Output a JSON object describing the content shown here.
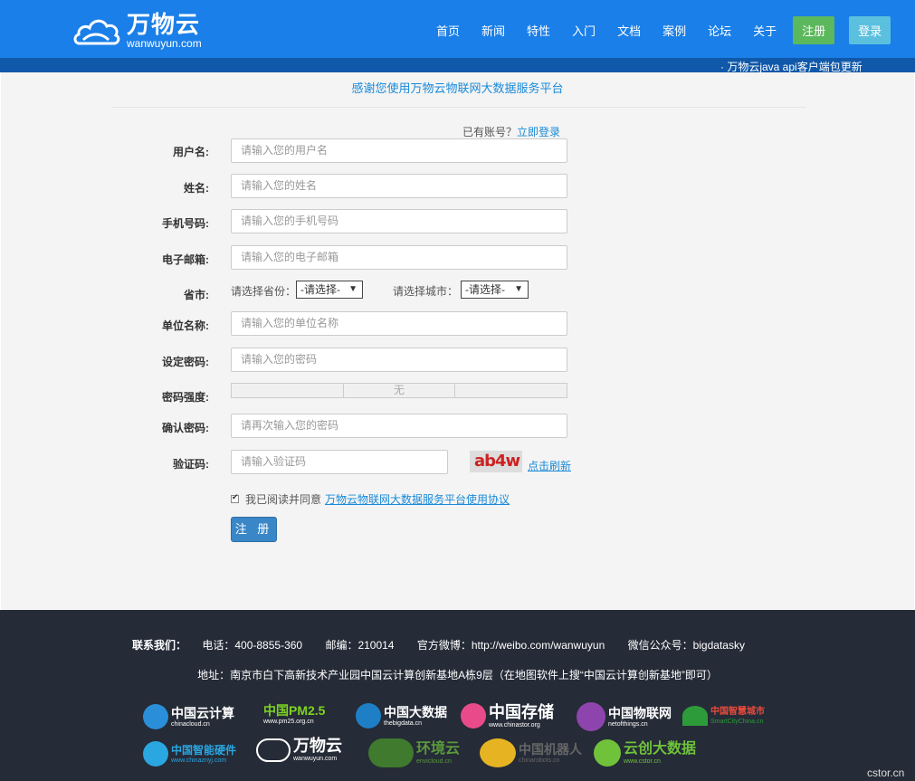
{
  "header": {
    "logo_cn": "万物云",
    "logo_en": "wanwuyun.com",
    "nav": [
      "首页",
      "新闻",
      "特性",
      "入门",
      "文档",
      "案例",
      "论坛",
      "关于"
    ],
    "register_label": "注册",
    "login_label": "登录"
  },
  "marquee": {
    "text": "· 万物云java api客户端包更新"
  },
  "main": {
    "thanks": "感谢您使用万物云物联网大数据服务平台",
    "have_account": "已有账号？",
    "login_link": "立即登录"
  },
  "form": {
    "username": {
      "label": "用户名:",
      "placeholder": "请输入您的用户名"
    },
    "name": {
      "label": "姓名:",
      "placeholder": "请输入您的姓名"
    },
    "phone": {
      "label": "手机号码:",
      "placeholder": "请输入您的手机号码"
    },
    "email": {
      "label": "电子邮箱:",
      "placeholder": "请输入您的电子邮箱"
    },
    "region": {
      "label": "省市:",
      "province_label": "请选择省份：",
      "province_value": "-请选择-",
      "city_label": "请选择城市：",
      "city_value": "-请选择-"
    },
    "company": {
      "label": "单位名称:",
      "placeholder": "请输入您的单位名称"
    },
    "password": {
      "label": "设定密码:",
      "placeholder": "请输入您的密码"
    },
    "strength": {
      "label": "密码强度:",
      "levels": [
        "",
        "无",
        ""
      ]
    },
    "confirm": {
      "label": "确认密码:",
      "placeholder": "请再次输入您的密码"
    },
    "captcha": {
      "label": "验证码:",
      "placeholder": "请输入验证码",
      "image_text": "ab4w",
      "refresh": "点击刷新"
    },
    "agree": {
      "text": "我已阅读并同意",
      "link": "万物云物联网大数据服务平台使用协议",
      "checked": true
    },
    "submit": "注 册"
  },
  "footer": {
    "contact_label": "联系我们：",
    "phone": "电话：400-8855-360",
    "postcode": "邮编：210014",
    "weibo": "官方微博：http://weibo.com/wanwuyun",
    "wechat": "微信公众号：bigdatasky",
    "address": "地址：南京市白下高新技术产业园中国云计算创新基地A栋9层（在地图软件上搜“中国云计算创新基地”即可）",
    "partners_row1": [
      {
        "name": "中国云计算",
        "url": "chinacloud.cn",
        "color": "#ffffff"
      },
      {
        "name": "中国PM2.5",
        "url": "www.pm25.org.cn",
        "color": "#7ed321"
      },
      {
        "name": "中国大数据",
        "url": "thebigdata.cn",
        "color": "#ffffff"
      },
      {
        "name": "中国存储",
        "url": "www.chinastor.org",
        "color": "#ffffff"
      },
      {
        "name": "中国物联网",
        "url": "netofthings.cn",
        "color": "#ffffff"
      },
      {
        "name": "中国智慧城市",
        "url": "SmartCityChina.cn",
        "color": "#e94b3c"
      }
    ],
    "partners_row2": [
      {
        "name": "中国智能硬件",
        "url": "www.chinaznyj.com",
        "color": "#2aa6e0"
      },
      {
        "name": "万物云",
        "url": "wanwuyun.com",
        "color": "#ffffff"
      },
      {
        "name": "环境云",
        "url": "envicloud.cn",
        "color": "#5a9a3b"
      },
      {
        "name": "中国机器人",
        "url": "chinarobots.cn",
        "color": "#666666"
      },
      {
        "name": "云创大数据",
        "url": "www.cstor.cn",
        "color": "#6fc23a"
      }
    ]
  },
  "watermark": "cstor.cn"
}
